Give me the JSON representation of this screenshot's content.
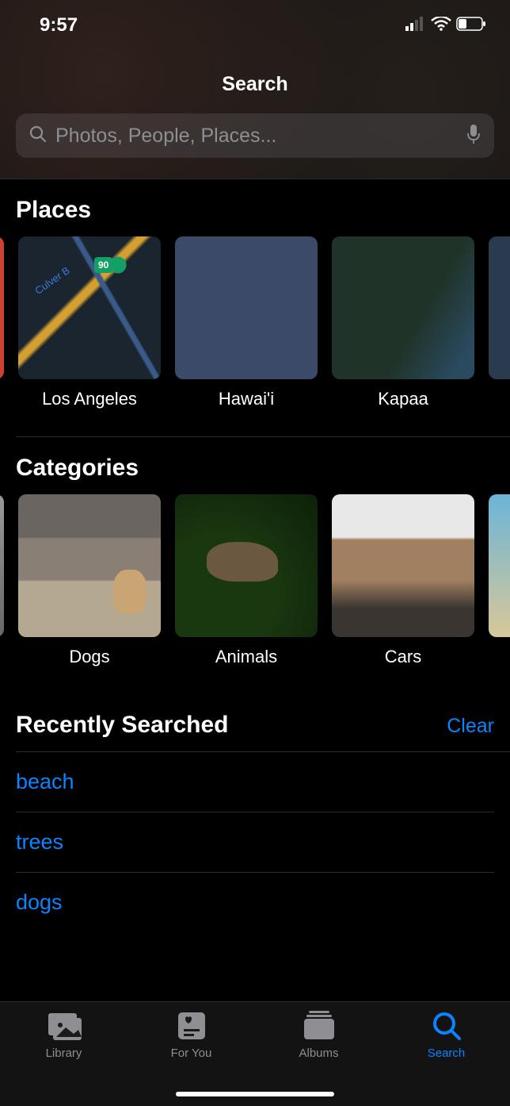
{
  "status": {
    "time": "9:57"
  },
  "header": {
    "title": "Search"
  },
  "search": {
    "placeholder": "Photos, People, Places..."
  },
  "places": {
    "title": "Places",
    "items": [
      {
        "label": "Los Angeles",
        "badge": "90",
        "creek": "Culver B"
      },
      {
        "label": "Hawai'i"
      },
      {
        "label": "Kapaa"
      }
    ]
  },
  "categories": {
    "title": "Categories",
    "items": [
      {
        "label": "Dogs"
      },
      {
        "label": "Animals"
      },
      {
        "label": "Cars"
      }
    ]
  },
  "recent": {
    "title": "Recently Searched",
    "clear": "Clear",
    "items": [
      "beach",
      "trees",
      "dogs"
    ]
  },
  "tabbar": {
    "library": "Library",
    "foryou": "For You",
    "albums": "Albums",
    "search": "Search"
  }
}
